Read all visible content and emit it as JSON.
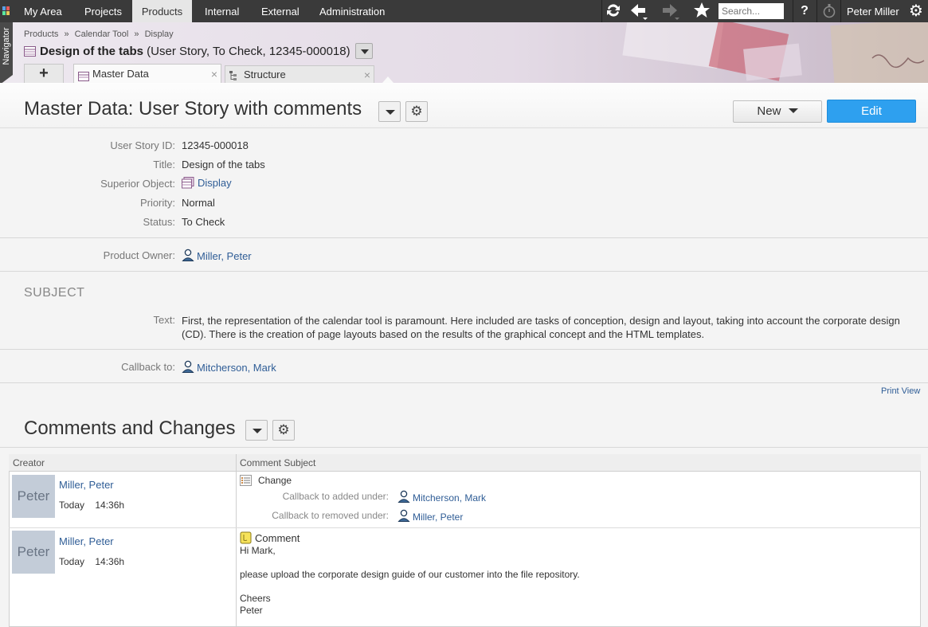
{
  "topnav": {
    "items": [
      "My Area",
      "Projects",
      "Products",
      "Internal",
      "External",
      "Administration"
    ],
    "search_placeholder": "Search...",
    "help": "?",
    "user": "Peter Miller"
  },
  "navigator": {
    "label": "Navigator"
  },
  "breadcrumb": [
    "Products",
    "»",
    "Calendar Tool",
    "»",
    "Display"
  ],
  "object": {
    "title_bold": "Design of the tabs",
    "title_rest": " (User Story, To Check, 12345-000018)"
  },
  "tabs": {
    "add": "+",
    "items": [
      "Master Data",
      "Structure"
    ],
    "close": "×"
  },
  "page": {
    "title": "Master Data: User Story with comments",
    "new_label": "New",
    "edit_label": "Edit"
  },
  "fields": {
    "user_story_id_label": "User Story ID:",
    "user_story_id": "12345-000018",
    "title_label": "Title:",
    "title": "Design of the tabs",
    "superior_label": "Superior Object:",
    "superior": "Display",
    "priority_label": "Priority:",
    "priority": "Normal",
    "status_label": "Status:",
    "status": "To Check",
    "owner_label": "Product Owner:",
    "owner": "Miller, Peter",
    "subject_heading": "SUBJECT",
    "text_label": "Text:",
    "text": "First, the representation of the calendar tool is paramount. Here included are tasks of conception, design and layout, taking into account the corporate design (CD). There is the creation of page layouts based on the results of the graphical concept and the HTML templates.",
    "callback_label": "Callback to:",
    "callback": "Mitcherson, Mark"
  },
  "print_view": "Print View",
  "comments": {
    "title": "Comments and Changes",
    "col_creator": "Creator",
    "col_subject": "Comment Subject",
    "rows": [
      {
        "avatar": "Peter",
        "name": "Miller, Peter",
        "day": "Today",
        "time": "14:36h",
        "type": "Change",
        "added_label": "Callback to added under:",
        "added": "Mitcherson, Mark",
        "removed_label": "Callback to removed under:",
        "removed": "Miller, Peter"
      },
      {
        "avatar": "Peter",
        "name": "Miller, Peter",
        "day": "Today",
        "time": "14:36h",
        "type": "Comment",
        "line1": "Hi Mark,",
        "line2": "please upload the corporate design guide of our customer into the file repository.",
        "line3": "Cheers",
        "line4": "Peter"
      }
    ]
  }
}
